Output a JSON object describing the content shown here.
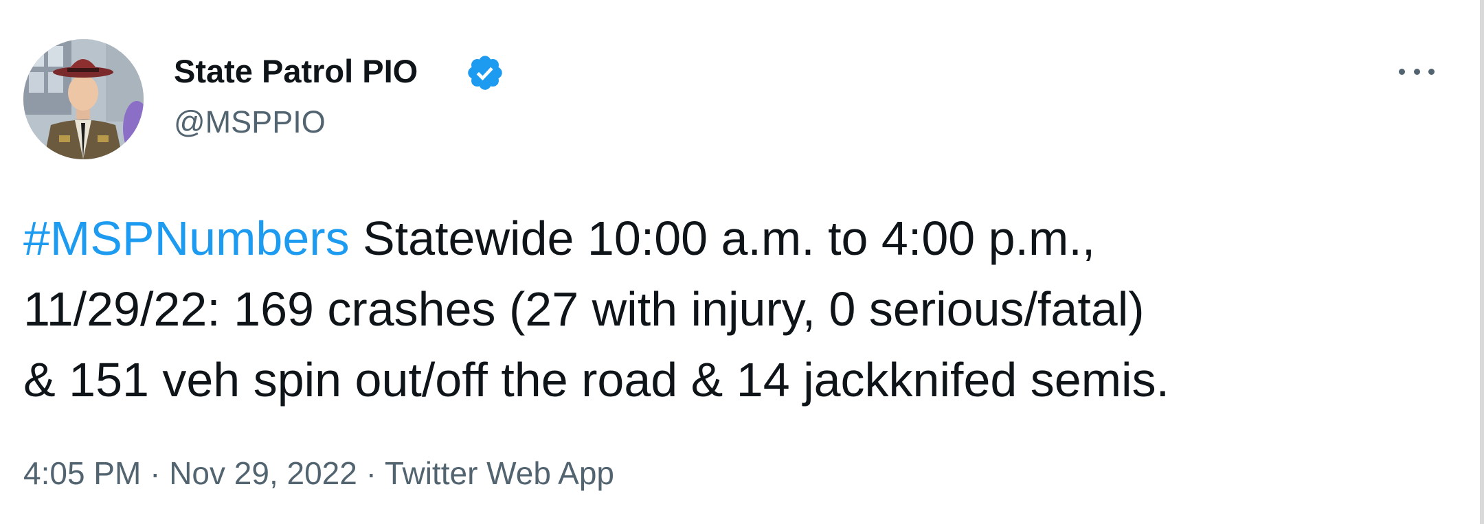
{
  "author": {
    "display_name": "State Patrol PIO",
    "handle": "@MSPPIO",
    "verified_icon": "verified-badge-icon",
    "avatar_description": "avatar"
  },
  "more_menu": {
    "icon": "more-horizontal-icon"
  },
  "tweet": {
    "hashtag": "#MSPNumbers",
    "line1_rest": " Statewide 10:00 a.m. to 4:00 p.m.,",
    "line2": "11/29/22: 169 crashes (27 with injury, 0 serious/fatal)",
    "line3": "& 151 veh spin out/off the road & 14 jackknifed semis."
  },
  "meta": {
    "time": "4:05 PM",
    "separator": "·",
    "date": "Nov 29, 2022",
    "source": "Twitter Web App"
  },
  "colors": {
    "accent": "#1d9bf0",
    "text": "#0f1419",
    "secondary": "#536471"
  }
}
